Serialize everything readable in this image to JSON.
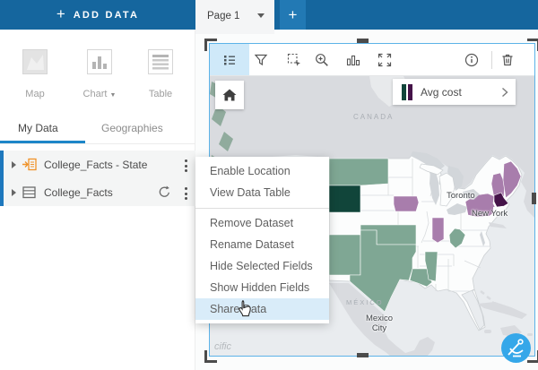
{
  "topbar": {
    "add_data_label": "ADD DATA",
    "plus": "+"
  },
  "page_tabs": {
    "active_tab": "Page 1",
    "new_tab_label": "+"
  },
  "sidebar": {
    "tools": [
      {
        "label": "Map"
      },
      {
        "label": "Chart"
      },
      {
        "label": "Table"
      }
    ],
    "tabs": [
      {
        "label": "My Data"
      },
      {
        "label": "Geographies"
      }
    ],
    "datasets": [
      {
        "name": "College_Facts - State",
        "icon": "join-icon"
      },
      {
        "name": "College_Facts",
        "icon": "table-icon"
      }
    ]
  },
  "context_menu": {
    "items": [
      "Enable Location",
      "View Data Table",
      "Remove Dataset",
      "Rename Dataset",
      "Hide Selected Fields",
      "Show Hidden Fields",
      "Share Data"
    ],
    "highlighted": "Share Data"
  },
  "map_card": {
    "toolbar_icons": [
      "legend",
      "filter",
      "selection",
      "zoom-in",
      "chart",
      "maximize",
      "info",
      "delete"
    ],
    "legend": {
      "field": "Avg cost"
    },
    "labels": {
      "canada": "CANADA",
      "toronto": "Toronto",
      "new_york": "New York",
      "mexico": "MÉXICO",
      "mexico_city": "Mexico City",
      "ocean_partial": "cific"
    }
  },
  "theme": {
    "header_blue": "#15669e",
    "plus_tab_blue": "#2279b4",
    "accent": "#1d86c8",
    "row_bar": "#1e78bd",
    "card_border": "#5cb3e8",
    "handle": "#4b4b4b",
    "menu_highlight": "#d9ecf9",
    "green_mid": "#7fa794",
    "green_dark": "#11453a",
    "purple_mid": "#a87dac",
    "purple_dark": "#451349",
    "fab_blue": "#35a7e9",
    "land": "#d9dbdf",
    "ocean": "#e9ecef",
    "lake": "#d2d6da",
    "green_isle": "#90ab9d",
    "orange_icon": "#f0932a"
  }
}
